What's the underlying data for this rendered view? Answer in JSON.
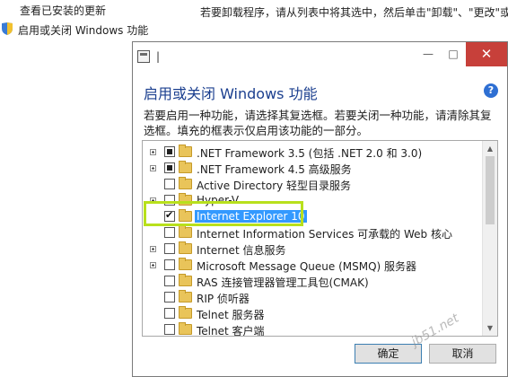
{
  "background": {
    "link_updates": "查看已安装的更新",
    "link_features": "启用或关闭 Windows 功能",
    "instructions": "若要卸载程序，请从列表中将其选中，然后单击\"卸载\"、\"更改\"或"
  },
  "dialog": {
    "title_text": "|",
    "minimize": "—",
    "maximize": "□",
    "close": "✕",
    "heading": "启用或关闭 Windows 功能",
    "help": "?",
    "description": "若要启用一种功能，请选择其复选框。若要关闭一种功能，请清除其复选框。填充的框表示仅启用该功能的一部分。",
    "features": [
      {
        "label": ".NET Framework 3.5 (包括 .NET 2.0 和 3.0)",
        "expandable": true,
        "state": "partial"
      },
      {
        "label": ".NET Framework 4.5 高级服务",
        "expandable": true,
        "state": "partial"
      },
      {
        "label": "Active Directory 轻型目录服务",
        "expandable": false,
        "state": "unchecked"
      },
      {
        "label": "Hyper-V",
        "expandable": true,
        "state": "unchecked"
      },
      {
        "label": "Internet Explorer 10",
        "expandable": false,
        "state": "checked",
        "selected": true
      },
      {
        "label": "Internet Information Services 可承载的 Web 核心",
        "expandable": false,
        "state": "unchecked"
      },
      {
        "label": "Internet 信息服务",
        "expandable": true,
        "state": "unchecked"
      },
      {
        "label": "Microsoft Message Queue (MSMQ) 服务器",
        "expandable": true,
        "state": "unchecked"
      },
      {
        "label": "RAS 连接管理器管理工具包(CMAK)",
        "expandable": false,
        "state": "unchecked"
      },
      {
        "label": "RIP 侦听器",
        "expandable": false,
        "state": "unchecked"
      },
      {
        "label": "Telnet 服务器",
        "expandable": false,
        "state": "unchecked"
      },
      {
        "label": "Telnet 客户端",
        "expandable": false,
        "state": "unchecked"
      }
    ],
    "ok_label": "确定",
    "cancel_label": "取消"
  },
  "watermark": "jb51.net",
  "colors": {
    "heading": "#1b3f8f",
    "selection": "#3399ff",
    "highlight_box": "#b8e01c",
    "close_button": "#c7403a"
  }
}
